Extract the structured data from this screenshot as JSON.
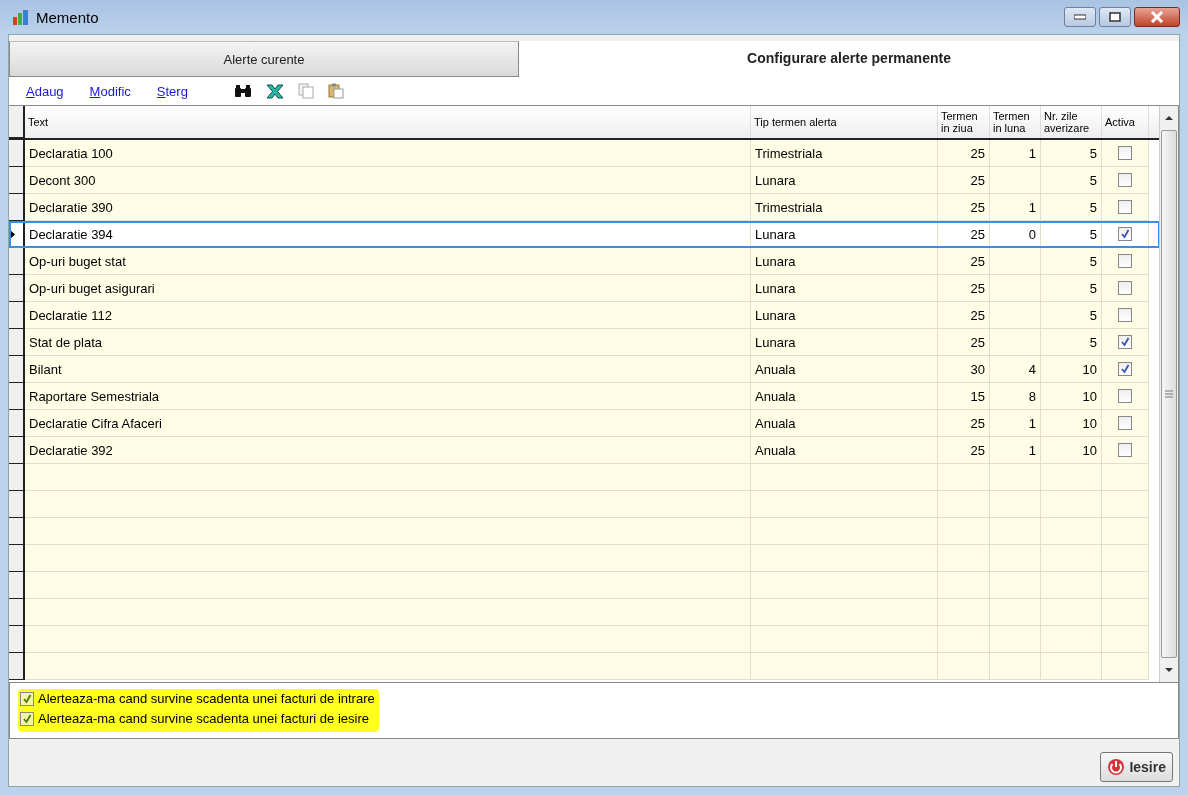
{
  "window": {
    "title": "Memento"
  },
  "tabs": [
    {
      "label": "Alerte curente",
      "selected": false
    },
    {
      "label": "Configurare alerte permanente",
      "selected": true
    }
  ],
  "toolbar": {
    "links": [
      "Adaug",
      "Modific",
      "Sterg"
    ]
  },
  "table": {
    "columns": [
      "Text",
      "Tip termen alerta",
      "Termen in ziua",
      "Termen in luna",
      "Nr. zile averizare",
      "Activa"
    ],
    "rows": [
      {
        "text": "Declaratia 100",
        "tip": "Trimestriala",
        "ziua": "25",
        "luna": "1",
        "zile": "5",
        "active": false,
        "selected": false
      },
      {
        "text": "Decont 300",
        "tip": "Lunara",
        "ziua": "25",
        "luna": "",
        "zile": "5",
        "active": false,
        "selected": false
      },
      {
        "text": "Declaratie 390",
        "tip": "Trimestriala",
        "ziua": "25",
        "luna": "1",
        "zile": "5",
        "active": false,
        "selected": false
      },
      {
        "text": "Declaratie 394",
        "tip": "Lunara",
        "ziua": "25",
        "luna": "0",
        "zile": "5",
        "active": true,
        "selected": true
      },
      {
        "text": "Op-uri buget stat",
        "tip": "Lunara",
        "ziua": "25",
        "luna": "",
        "zile": "5",
        "active": false,
        "selected": false
      },
      {
        "text": "Op-uri buget asigurari",
        "tip": "Lunara",
        "ziua": "25",
        "luna": "",
        "zile": "5",
        "active": false,
        "selected": false
      },
      {
        "text": "Declaratie 112",
        "tip": "Lunara",
        "ziua": "25",
        "luna": "",
        "zile": "5",
        "active": false,
        "selected": false
      },
      {
        "text": "Stat de plata",
        "tip": "Lunara",
        "ziua": "25",
        "luna": "",
        "zile": "5",
        "active": true,
        "selected": false
      },
      {
        "text": "Bilant",
        "tip": "Anuala",
        "ziua": "30",
        "luna": "4",
        "zile": "10",
        "active": true,
        "selected": false
      },
      {
        "text": "Raportare Semestriala",
        "tip": "Anuala",
        "ziua": "15",
        "luna": "8",
        "zile": "10",
        "active": false,
        "selected": false
      },
      {
        "text": "Declaratie Cifra Afaceri",
        "tip": "Anuala",
        "ziua": "25",
        "luna": "1",
        "zile": "10",
        "active": false,
        "selected": false
      },
      {
        "text": "Declaratie 392",
        "tip": "Anuala",
        "ziua": "25",
        "luna": "1",
        "zile": "10",
        "active": false,
        "selected": false
      }
    ]
  },
  "options": [
    {
      "label": "Alerteaza-ma cand survine scadenta unei facturi de intrare",
      "checked": true
    },
    {
      "label": "Alerteaza-ma cand survine scadenta unei facturi de iesire",
      "checked": true
    }
  ],
  "exit_button": {
    "label": "Iesire"
  }
}
